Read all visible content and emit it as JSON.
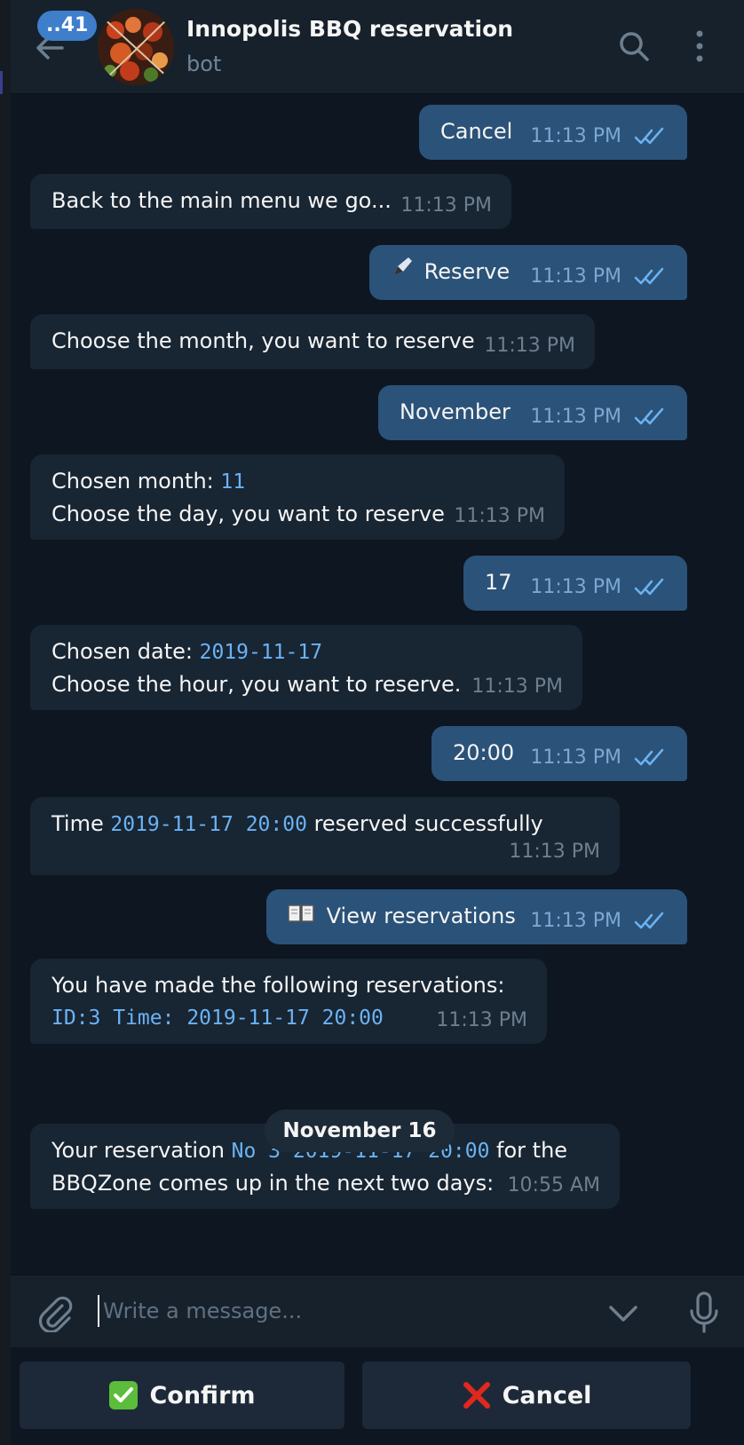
{
  "header": {
    "back_icon": "arrow-left-icon",
    "unread_count": "..41",
    "title": "Innopolis BBQ reservation",
    "subtitle": "bot",
    "search_icon": "search-icon",
    "menu_icon": "more-vertical-icon"
  },
  "messages": [
    {
      "side": "out",
      "text": "Cancel",
      "time": "11:13 PM"
    },
    {
      "side": "in",
      "text": "Back to the main menu we go...",
      "time": "11:13 PM"
    },
    {
      "side": "out",
      "text": "🖋️ Reserve",
      "label": "Reserve",
      "time": "11:13 PM"
    },
    {
      "side": "in",
      "text": "Choose the month, you want to reserve",
      "time": "11:13 PM"
    },
    {
      "side": "out",
      "text": "November",
      "time": "11:13 PM"
    },
    {
      "side": "in",
      "line1_prefix": "Chosen month: ",
      "line1_code": "11",
      "line2": "Choose the day, you want to reserve",
      "time": "11:13 PM"
    },
    {
      "side": "out",
      "text": "17",
      "time": "11:13 PM"
    },
    {
      "side": "in",
      "line1_prefix": "Chosen date: ",
      "line1_code": "2019-11-17",
      "line2": "Choose the hour, you want to reserve.",
      "time": "11:13 PM"
    },
    {
      "side": "out",
      "text": "20:00",
      "time": "11:13 PM"
    },
    {
      "side": "in",
      "prefix": "Time ",
      "code": "2019-11-17 20:00",
      "suffix": " reserved successfully",
      "time": "11:13 PM"
    },
    {
      "side": "out",
      "text": "View reservations",
      "time": "11:13 PM"
    },
    {
      "side": "in",
      "line1": "You have made the following reservations:",
      "line2_code": "ID:3 Time: 2019-11-17 20:00",
      "time": "11:13 PM"
    },
    {
      "side": "in",
      "prefix": "Your reservation ",
      "code": "No 3 2019-11-17 20:00",
      "suffix": " for the",
      "line2": "BBQZone comes up in the next two days:",
      "time": "10:55 AM"
    }
  ],
  "date_separator": "November 16",
  "composer": {
    "placeholder": "Write a message...",
    "attach_icon": "paperclip-icon",
    "keyboard_toggle_icon": "chevron-down-icon",
    "mic_icon": "microphone-icon"
  },
  "keyboard": {
    "confirm_label": "Confirm",
    "cancel_label": "Cancel"
  },
  "colors": {
    "background": "#0e1621",
    "header": "#17212b",
    "incoming_bubble": "#182533",
    "outgoing_bubble": "#2b5278",
    "accent": "#6ab3f3",
    "badge": "#3e7ecb"
  }
}
